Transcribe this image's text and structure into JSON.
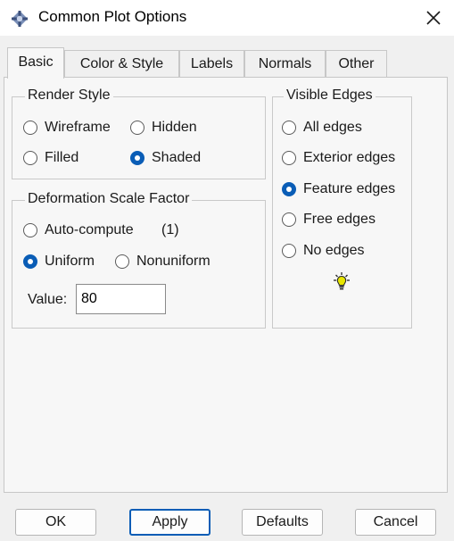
{
  "window": {
    "title": "Common Plot Options",
    "icon": "app-diamond-icon",
    "close_icon": "close-icon"
  },
  "tabs": [
    {
      "label": "Basic",
      "active": true
    },
    {
      "label": "Color & Style",
      "active": false
    },
    {
      "label": "Labels",
      "active": false
    },
    {
      "label": "Normals",
      "active": false
    },
    {
      "label": "Other",
      "active": false
    }
  ],
  "render_style": {
    "title": "Render Style",
    "options": [
      {
        "label": "Wireframe",
        "selected": false
      },
      {
        "label": "Hidden",
        "selected": false
      },
      {
        "label": "Filled",
        "selected": false
      },
      {
        "label": "Shaded",
        "selected": true
      }
    ]
  },
  "deformation": {
    "title": "Deformation Scale Factor",
    "auto_label": "Auto-compute",
    "auto_value": "(1)",
    "uniform_label": "Uniform",
    "nonuniform_label": "Nonuniform",
    "selected": "Uniform",
    "value_label": "Value:",
    "value": "80"
  },
  "visible_edges": {
    "title": "Visible Edges",
    "options": [
      {
        "label": "All edges",
        "selected": false
      },
      {
        "label": "Exterior edges",
        "selected": false
      },
      {
        "label": "Feature edges",
        "selected": true
      },
      {
        "label": "Free edges",
        "selected": false
      },
      {
        "label": "No edges",
        "selected": false
      }
    ],
    "hint_icon": "lightbulb-icon"
  },
  "buttons": {
    "ok": "OK",
    "apply": "Apply",
    "defaults": "Defaults",
    "cancel": "Cancel"
  },
  "colors": {
    "accent": "#0a5db6",
    "bulb": "#e8e600"
  }
}
